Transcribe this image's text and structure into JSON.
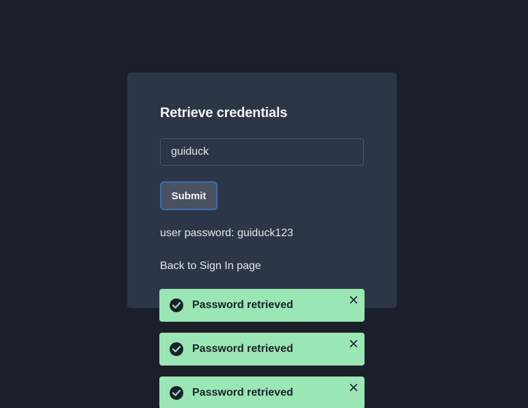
{
  "card": {
    "title": "Retrieve credentials",
    "username_value": "guiduck",
    "submit_label": "Submit",
    "result_text": "user password: guiduck123",
    "back_link_label": "Back to Sign In page"
  },
  "toasts": [
    {
      "title": "Password retrieved",
      "icon": "check-circle-icon",
      "close_icon": "close-icon"
    },
    {
      "title": "Password retrieved",
      "icon": "check-circle-icon",
      "close_icon": "close-icon"
    },
    {
      "title": "Password retrieved",
      "icon": "check-circle-icon",
      "close_icon": "close-icon"
    }
  ],
  "colors": {
    "background": "#1b1f2a",
    "card": "#2d3647",
    "toast_success": "#9ae6b4",
    "focus_ring": "#3b6fb0"
  }
}
